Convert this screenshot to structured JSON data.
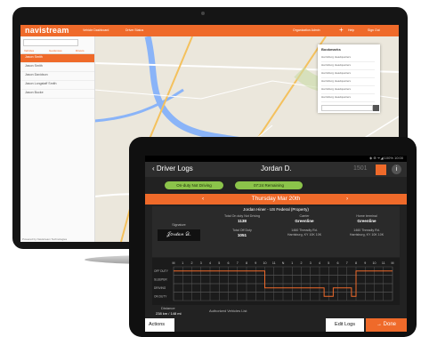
{
  "desktop": {
    "brand": "navistream",
    "top_nav": [
      "Vehicle Dashboard",
      "Driver Status",
      "Organization Admin",
      "Help",
      "Sign Out"
    ],
    "tabs": [
      "Vehicles",
      "Geofences",
      "Drivers"
    ],
    "driver_list": [
      "Jason Smith",
      "Jason Smith",
      "Jason Davidson",
      "Jason Longstaff Smith",
      "Jason Bucke"
    ],
    "footer": "Powered by Navistream Technologies",
    "bookmarks_title": "Bookmarks",
    "bookmarks": [
      "Harrisburg Headquarters",
      "Harrisburg Headquarters",
      "Harrisburg Headquarters",
      "Harrisburg Headquarters",
      "Harrisburg Headquarters",
      "Harrisburg Headquarters"
    ]
  },
  "tablet": {
    "status_text": "◈ ⊕ ᯤ◢ 100% 10:00",
    "title": "Driver Logs",
    "driver_name": "Jordan D.",
    "log_number": "1501",
    "status_pill": "On-duty Not Driving",
    "remaining_pill": "07:24 Remaining",
    "date": "Thursday Mar 20th",
    "summary_head": "Jordan Hiner - US Federal (Property)",
    "signature_label": "Signature",
    "signature": "𝒥𝑜𝓇𝒹𝒶𝓃 𝒟.",
    "total_on_duty_label": "Total On duty Not Driving",
    "total_on_duty": "1138",
    "carrier_label": "Carrier",
    "carrier": "Greenline",
    "home_terminal_label": "Home terminal",
    "home_terminal": "Greenline",
    "total_off_duty_label": "Total Off Duty",
    "total_off_duty": "1051",
    "address1": "1460 Threadly Rd.",
    "address1b": "Harrisburg, KY 10K 10K",
    "address2": "1460 Threadly Rd.",
    "address2b": "Harrisburg, KY 10K 10K",
    "hours": [
      "M",
      "1",
      "2",
      "3",
      "4",
      "5",
      "6",
      "7",
      "8",
      "9",
      "10",
      "11",
      "N",
      "1",
      "2",
      "3",
      "4",
      "5",
      "6",
      "7",
      "8",
      "9",
      "10",
      "11",
      "M"
    ],
    "rows": [
      "OFF DUTY",
      "SLEEPER",
      "DRIVING",
      "ON DUTY"
    ],
    "distance_label": "Distance",
    "distance": "238 km / 148 mi",
    "vehicles_label": "Authorized Vehicles List",
    "actions": "Actions",
    "edit_logs": "Edit Logs",
    "done": "Done",
    "done_arrow": "→"
  }
}
